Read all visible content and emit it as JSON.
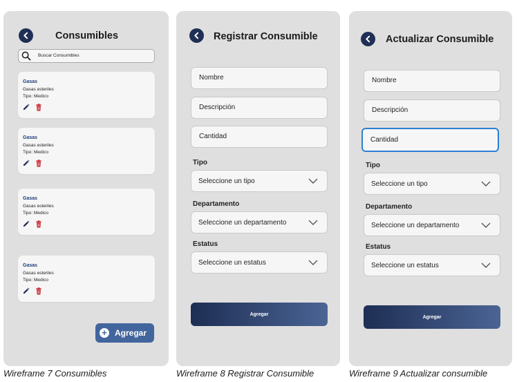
{
  "screens": [
    {
      "title": "Consumibles",
      "search": {
        "placeholder": "Buscar Consumibles"
      },
      "items": [
        {
          "name": "Gasas",
          "description": "Gasas esteriles",
          "type": "Tipo: Medico"
        },
        {
          "name": "Gasas",
          "description": "Gasas esteriles",
          "type": "Tipo: Medico"
        },
        {
          "name": "Gasas",
          "description": "Gasas esteriles",
          "type": "Tipo: Medico"
        },
        {
          "name": "Gasas",
          "description": "Gasas esteriles",
          "type": "Tipo: Medico"
        }
      ],
      "add_button": "Agregar",
      "caption": "Wireframe 7 Consumibles"
    },
    {
      "title": "Registrar Consumible",
      "fields": {
        "name": "Nombre",
        "description": "Descripción",
        "quantity": "Cantidad"
      },
      "labels": {
        "type": "Tipo",
        "department": "Departamento",
        "status": "Estatus"
      },
      "selects": {
        "type": "Seleccione un tipo",
        "department": "Seleccione un departamento",
        "status": "Seleccione un estatus"
      },
      "submit": "Agregar",
      "caption": "Wireframe 8 Registrar Consumible"
    },
    {
      "title": "Actualizar Consumible",
      "fields": {
        "name": "Nombre",
        "description": "Descripción",
        "quantity": "Cantidad"
      },
      "labels": {
        "type": "Tipo",
        "department": "Departamento",
        "status": "Estatus"
      },
      "selects": {
        "type": "Seleccione un tipo",
        "department": "Seleccione un departamento",
        "status": "Seleccione un estatus"
      },
      "submit": "Agregar",
      "caption": "Wireframe 9 Actualizar consumible"
    }
  ],
  "icons": {
    "back": "arrow-left-icon",
    "search": "search-icon",
    "edit": "pencil-icon",
    "delete": "trash-icon",
    "add": "plus-circle-icon",
    "dropdown": "chevron-down-icon"
  },
  "colors": {
    "navy": "#1f2f55",
    "accent_blue": "#42659d",
    "focus_blue": "#2b7fd4",
    "delete_red": "#c8242b",
    "item_title": "#1f3f7a"
  }
}
